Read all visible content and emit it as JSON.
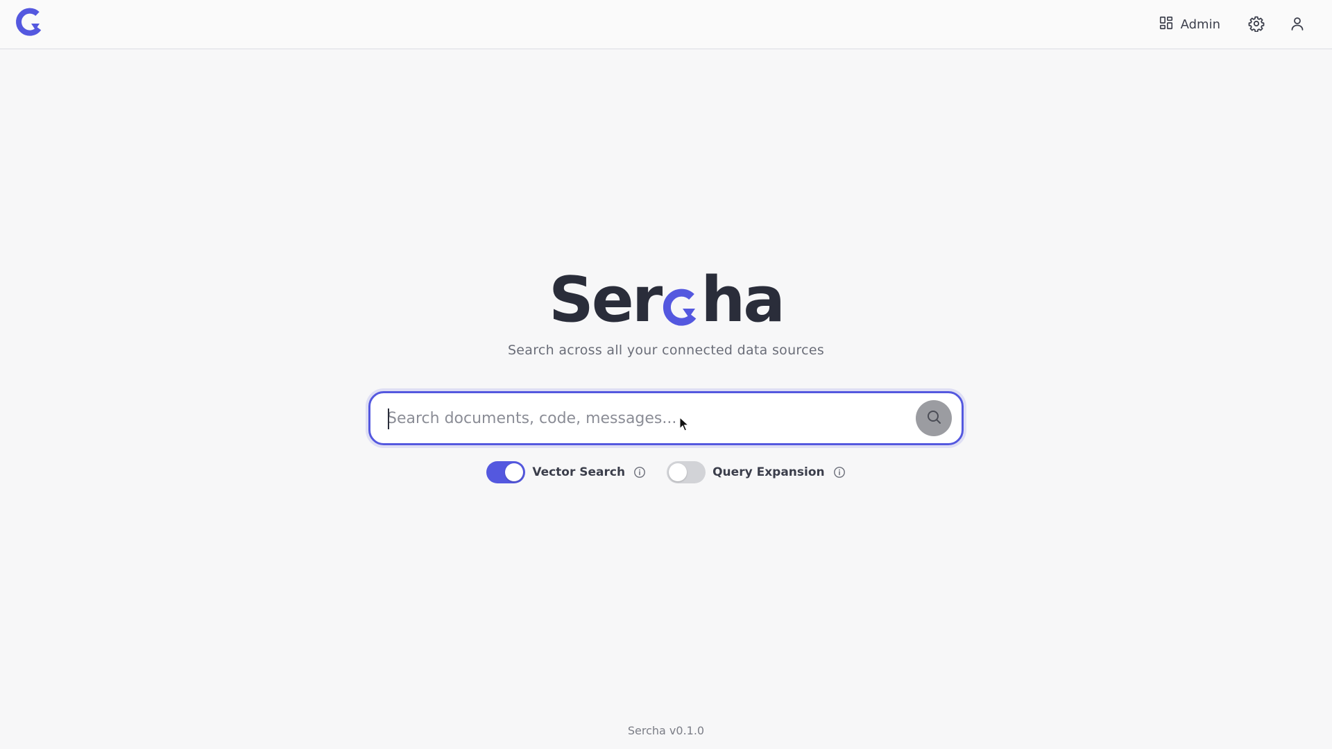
{
  "app": {
    "name": "Sercha",
    "wordmark_left": "Ser",
    "wordmark_right": "ha",
    "brand_color": "#5458df",
    "text_color": "#2a2d3a"
  },
  "header": {
    "logo_icon": "sercha-logo-icon",
    "admin_label": "Admin",
    "admin_icon": "grid-icon",
    "settings_icon": "gear-icon",
    "profile_icon": "user-icon"
  },
  "hero": {
    "tagline": "Search across all your connected data sources"
  },
  "search": {
    "placeholder": "Search documents, code, messages...",
    "value": "",
    "submit_icon": "search-icon"
  },
  "options": [
    {
      "label": "Vector Search",
      "enabled": true,
      "info_icon": "info-icon"
    },
    {
      "label": "Query Expansion",
      "enabled": false,
      "info_icon": "info-icon"
    }
  ],
  "footer": {
    "version_text": "Sercha v0.1.0"
  }
}
